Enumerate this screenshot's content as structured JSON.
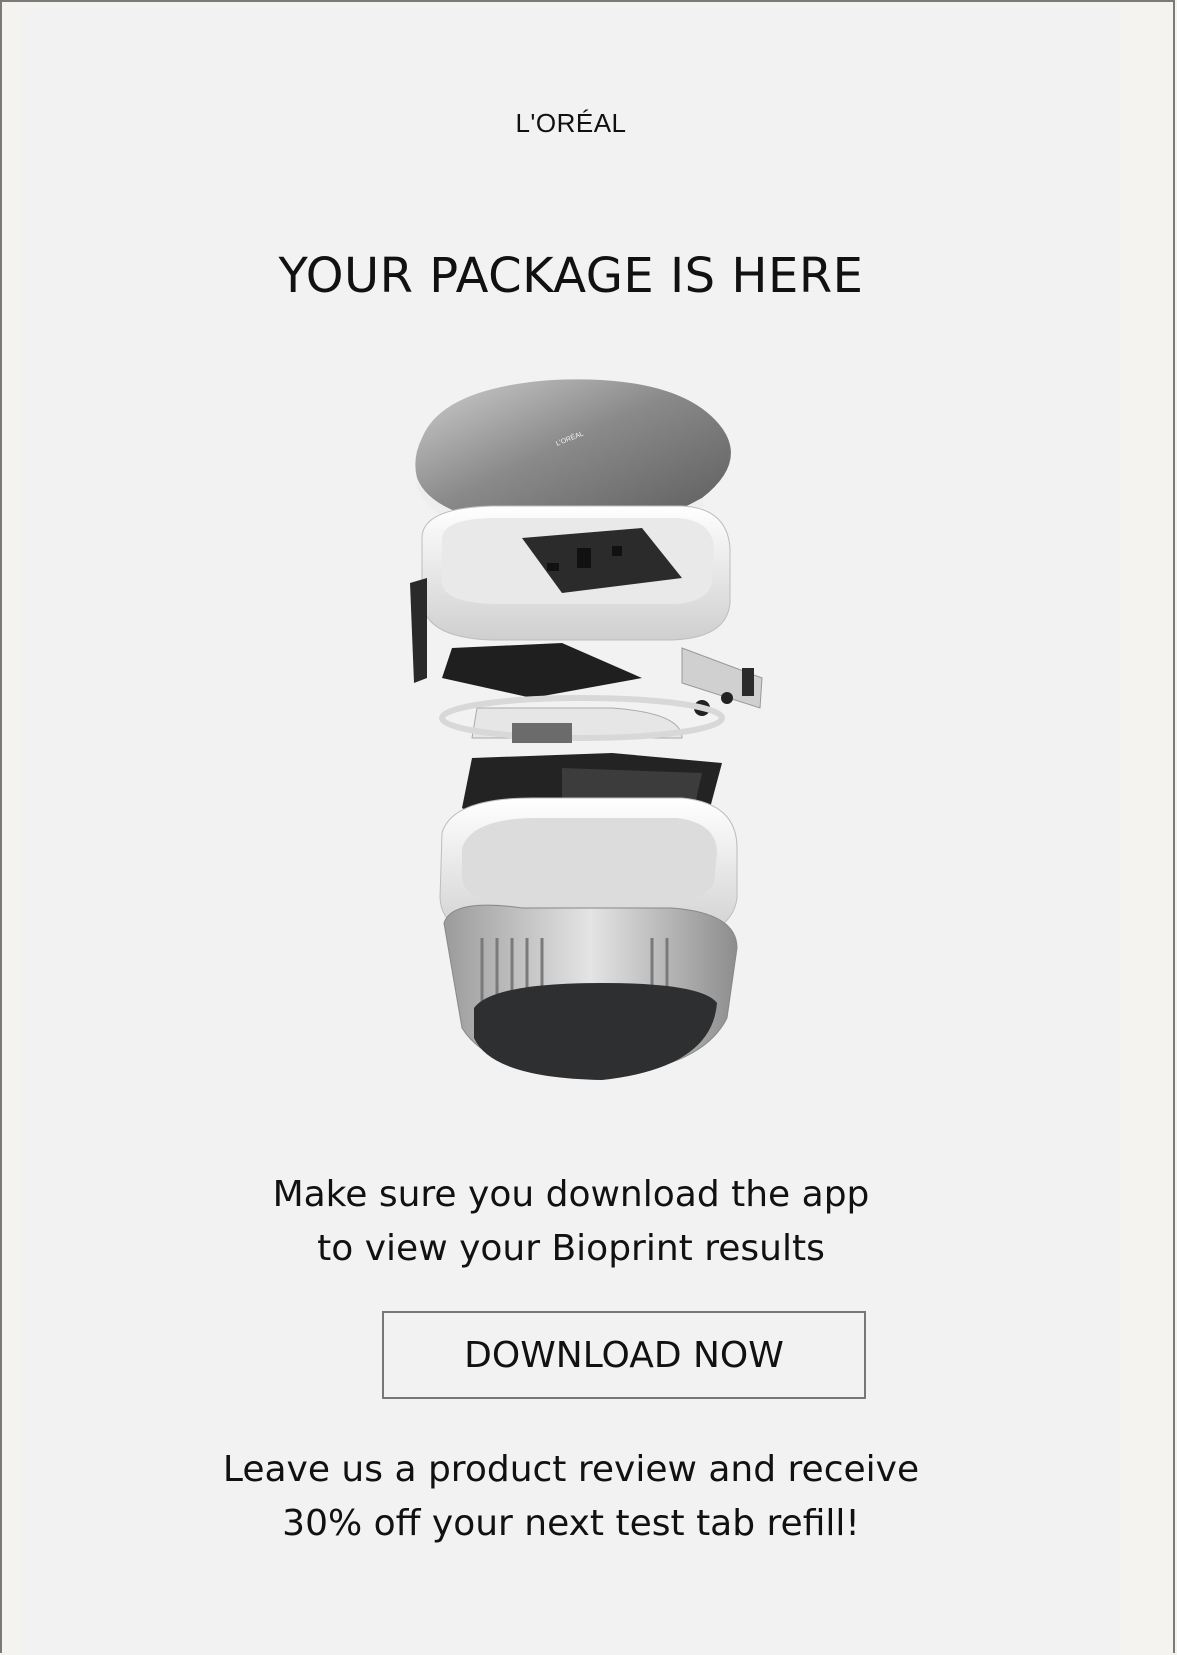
{
  "brand": {
    "logo_text": "L'ORÉAL"
  },
  "hero": {
    "headline": "YOUR PACKAGE IS HERE"
  },
  "device_image": {
    "alt": "Bioprint device exploded view",
    "logo_text": "L'ORÉAL"
  },
  "message": {
    "line1": "Make sure you download the app",
    "line2": "to view your Bioprint results"
  },
  "cta": {
    "label": "DOWNLOAD NOW"
  },
  "promo": {
    "line1": "Leave us a product review and receive",
    "line2": "30% off your next test tab refill!"
  },
  "colors": {
    "background": "#f2f2f2",
    "outer": "#f4f3ef",
    "text": "#111111",
    "button_border": "#777777"
  }
}
